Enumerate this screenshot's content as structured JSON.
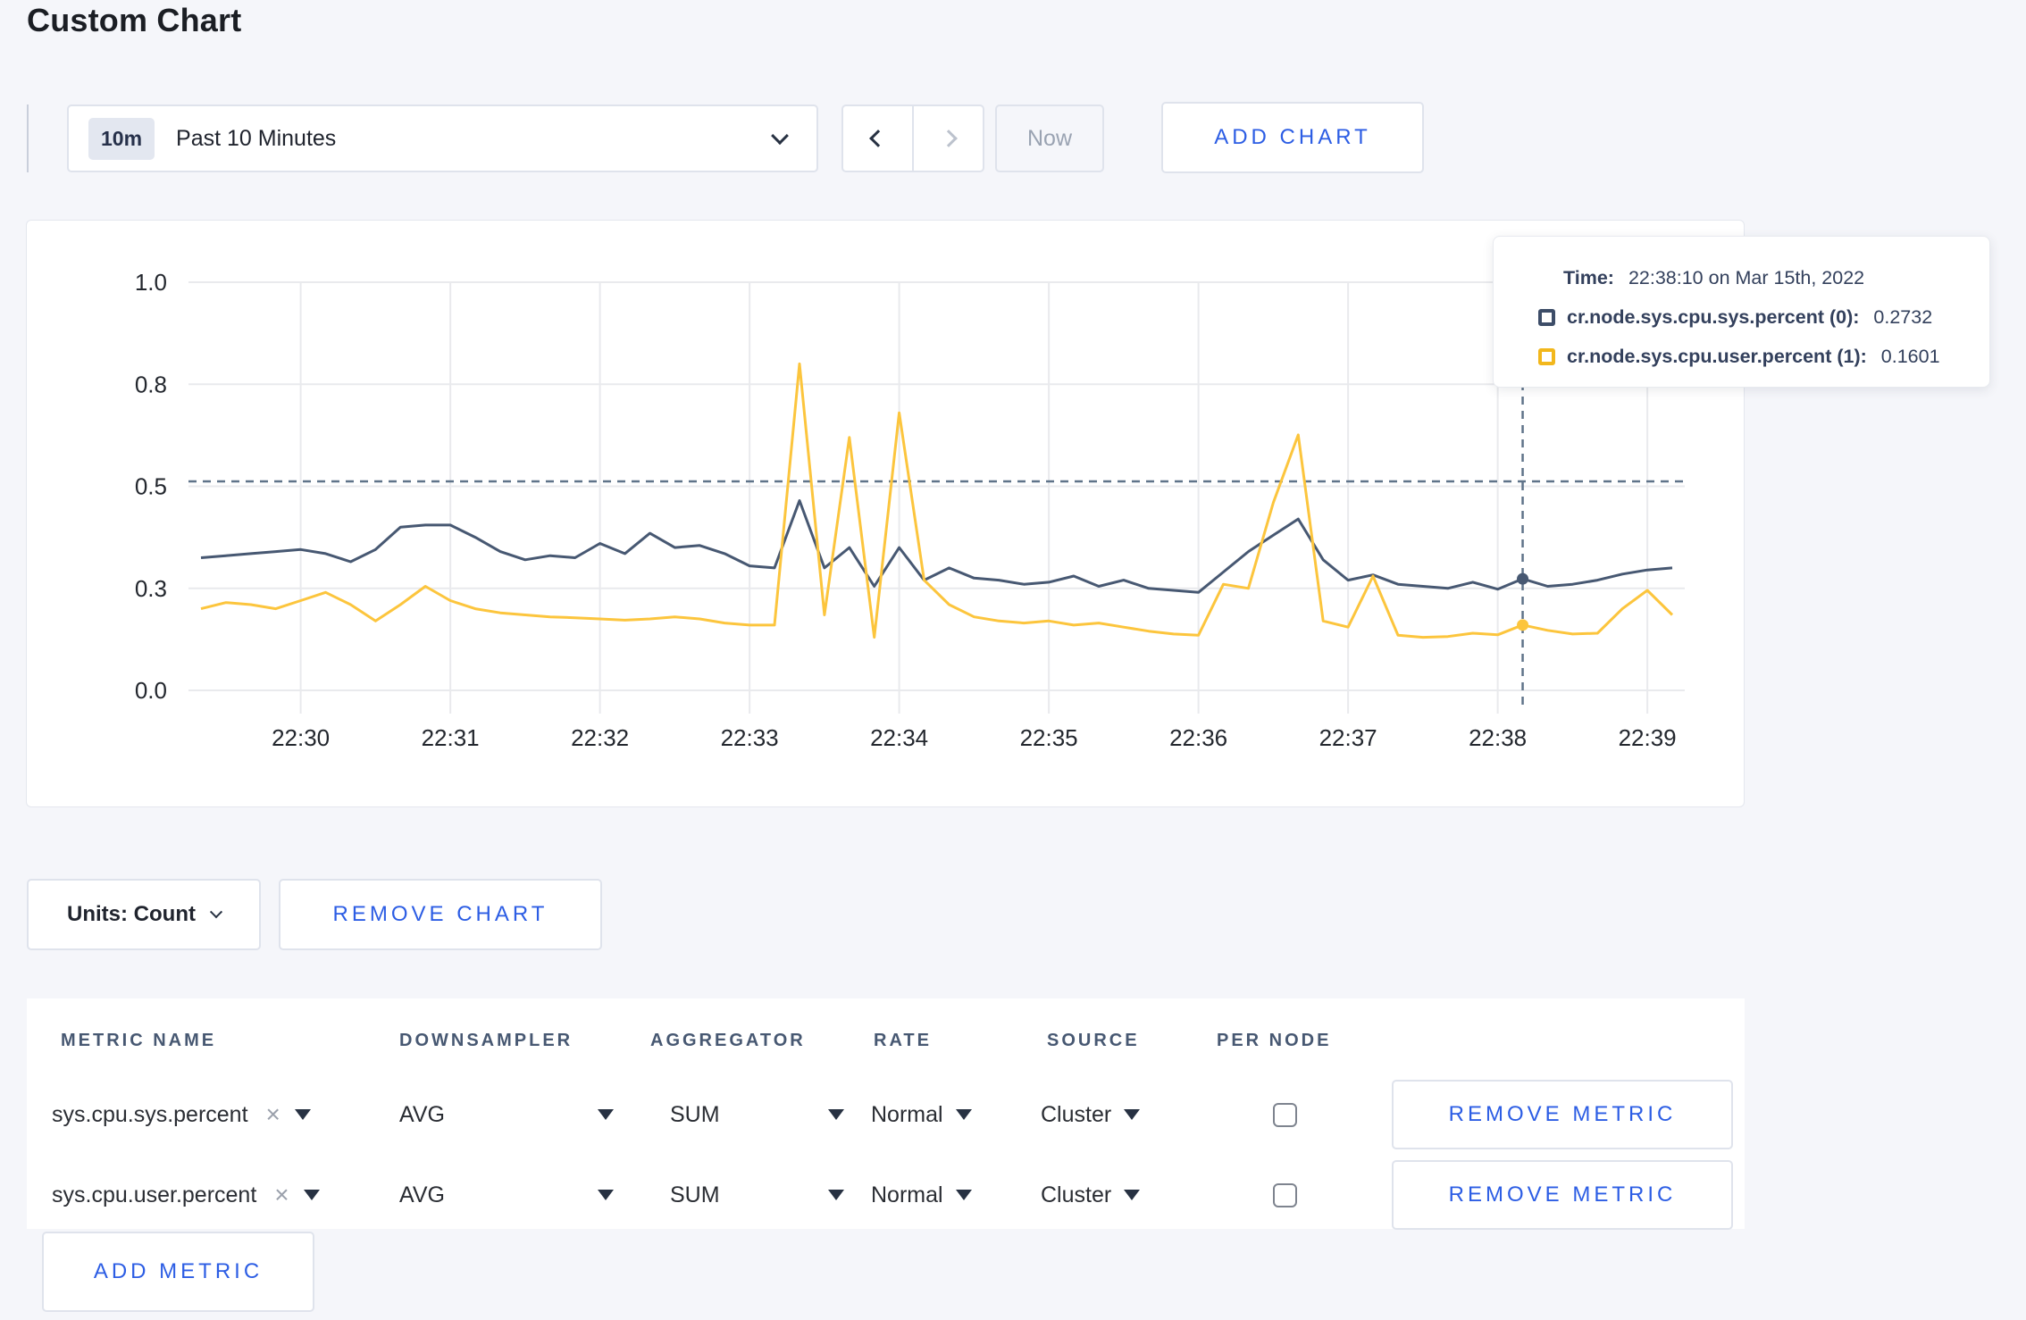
{
  "page": {
    "title": "Custom Chart"
  },
  "toolbar": {
    "range_badge": "10m",
    "range_label": "Past 10 Minutes",
    "now_label": "Now",
    "add_chart_label": "ADD CHART"
  },
  "chart_data": {
    "type": "line",
    "x_ticks": [
      "22:30",
      "22:31",
      "22:32",
      "22:33",
      "22:34",
      "22:35",
      "22:36",
      "22:37",
      "22:38",
      "22:39"
    ],
    "y_ticks": [
      {
        "label": "0.0",
        "value": 0
      },
      {
        "label": "0.3",
        "value": 0.25
      },
      {
        "label": "0.5",
        "value": 0.5
      },
      {
        "label": "0.8",
        "value": 0.75
      },
      {
        "label": "1.0",
        "value": 1.0
      }
    ],
    "ylim": [
      0,
      1
    ],
    "grid": true,
    "time_domain_start": "22:29:15",
    "time_domain_end": "22:39:15",
    "first_tick_offset_seconds": 45,
    "start_offset_seconds": 5,
    "sample_interval_seconds": 10,
    "series": [
      {
        "name": "cr.node.sys.cpu.sys.percent (0)",
        "color": "#475872",
        "values": [
          0.325,
          0.33,
          0.335,
          0.34,
          0.345,
          0.335,
          0.315,
          0.345,
          0.4,
          0.405,
          0.405,
          0.375,
          0.34,
          0.32,
          0.33,
          0.325,
          0.36,
          0.335,
          0.385,
          0.35,
          0.355,
          0.335,
          0.305,
          0.3,
          0.465,
          0.3,
          0.35,
          0.255,
          0.35,
          0.27,
          0.3,
          0.275,
          0.27,
          0.26,
          0.265,
          0.28,
          0.255,
          0.27,
          0.25,
          0.245,
          0.24,
          0.29,
          0.34,
          0.38,
          0.42,
          0.32,
          0.27,
          0.283,
          0.26,
          0.255,
          0.25,
          0.265,
          0.248,
          0.2732,
          0.255,
          0.26,
          0.27,
          0.285,
          0.295,
          0.3
        ]
      },
      {
        "name": "cr.node.sys.cpu.user.percent (1)",
        "color": "#fcc53d",
        "values": [
          0.2,
          0.215,
          0.21,
          0.2,
          0.22,
          0.24,
          0.21,
          0.17,
          0.21,
          0.255,
          0.22,
          0.2,
          0.19,
          0.185,
          0.18,
          0.178,
          0.175,
          0.172,
          0.175,
          0.18,
          0.175,
          0.165,
          0.16,
          0.16,
          0.8,
          0.185,
          0.62,
          0.13,
          0.68,
          0.27,
          0.21,
          0.18,
          0.17,
          0.165,
          0.17,
          0.16,
          0.165,
          0.155,
          0.145,
          0.138,
          0.135,
          0.26,
          0.25,
          0.46,
          0.626,
          0.17,
          0.155,
          0.28,
          0.135,
          0.13,
          0.132,
          0.14,
          0.136,
          0.1601,
          0.147,
          0.138,
          0.14,
          0.2,
          0.245,
          0.185
        ]
      }
    ],
    "crosshair": {
      "time": "22:38:10",
      "time_offset_seconds": 535,
      "hline_value": 0.512,
      "color": "#5f7389"
    },
    "gridline_color": "#e9eaed",
    "axis_text_color": "#23272e"
  },
  "tooltip": {
    "time_label": "Time:",
    "time_value": "22:38:10 on Mar 15th, 2022",
    "series": [
      {
        "name": "cr.node.sys.cpu.sys.percent (0):",
        "value": "0.2732",
        "swatch_color": "#3d4d68"
      },
      {
        "name": "cr.node.sys.cpu.user.percent (1):",
        "value": "0.1601",
        "swatch_color": "#f2b71c"
      }
    ]
  },
  "chart_controls": {
    "units_label": "Units: Count",
    "remove_chart_label": "REMOVE CHART"
  },
  "metrics_table": {
    "headers": {
      "metric_name": "METRIC NAME",
      "downsampler": "DOWNSAMPLER",
      "aggregator": "AGGREGATOR",
      "rate": "RATE",
      "source": "SOURCE",
      "per_node": "PER NODE"
    },
    "rows": [
      {
        "metric": "sys.cpu.sys.percent",
        "downsampler": "AVG",
        "aggregator": "SUM",
        "rate": "Normal",
        "source": "Cluster",
        "per_node_checked": false,
        "remove_label": "REMOVE METRIC"
      },
      {
        "metric": "sys.cpu.user.percent",
        "downsampler": "AVG",
        "aggregator": "SUM",
        "rate": "Normal",
        "source": "Cluster",
        "per_node_checked": false,
        "remove_label": "REMOVE METRIC"
      }
    ],
    "add_metric_label": "ADD METRIC"
  },
  "colors": {
    "accent_blue": "#2c5de4",
    "header_slate": "#475872",
    "page_background": "#f5f6fa"
  }
}
